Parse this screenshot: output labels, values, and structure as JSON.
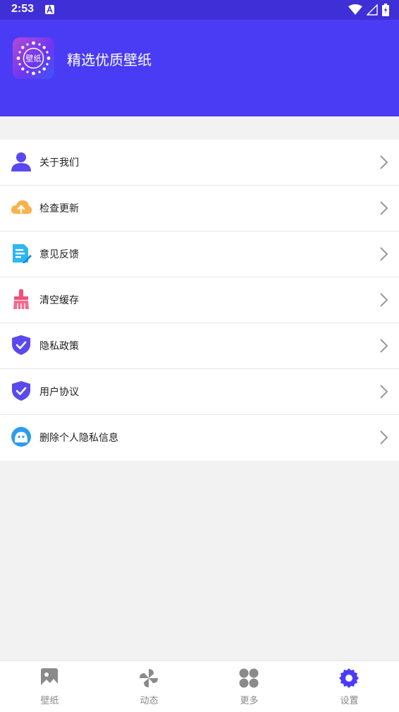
{
  "status_bar": {
    "time": "2:53"
  },
  "header": {
    "title": "精选优质壁纸",
    "logo_text": "壁纸"
  },
  "menu": [
    {
      "label": "关于我们",
      "icon": "user-icon"
    },
    {
      "label": "检查更新",
      "icon": "cloud-upload-icon"
    },
    {
      "label": "意见反馈",
      "icon": "feedback-doc-icon"
    },
    {
      "label": "清空缓存",
      "icon": "broom-icon"
    },
    {
      "label": "隐私政策",
      "icon": "shield-check-icon"
    },
    {
      "label": "用户协议",
      "icon": "shield-check-icon"
    },
    {
      "label": "删除个人隐私信息",
      "icon": "chat-bot-icon"
    }
  ],
  "tabs": [
    {
      "label": "壁纸",
      "icon": "image-icon",
      "active": false
    },
    {
      "label": "动态",
      "icon": "pinwheel-icon",
      "active": false
    },
    {
      "label": "更多",
      "icon": "grid-icon",
      "active": false
    },
    {
      "label": "设置",
      "icon": "gear-icon",
      "active": true
    }
  ],
  "colors": {
    "header": "#4a3cf5",
    "status_bar": "#3f2fd6",
    "accent": "#4a3cf5"
  }
}
